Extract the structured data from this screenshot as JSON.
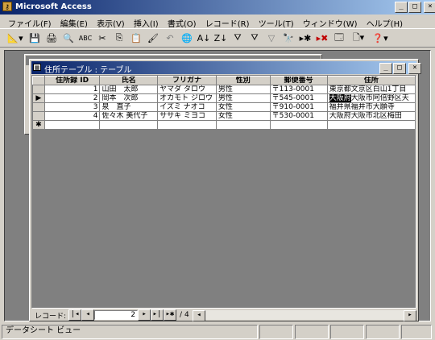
{
  "app": {
    "title": "Microsoft Access",
    "icon": "key-icon"
  },
  "menu": [
    "ファイル(F)",
    "編集(E)",
    "表示(V)",
    "挿入(I)",
    "書式(O)",
    "レコード(R)",
    "ツール(T)",
    "ウィンドウ(W)",
    "ヘルプ(H)"
  ],
  "table_window": {
    "title": "住所テーブル : テーブル",
    "columns": [
      "住所録 ID",
      "氏名",
      "フリガナ",
      "性別",
      "郵便番号",
      "住所"
    ],
    "rows": [
      [
        "1",
        "山田　太郎",
        "ヤマダ タロウ",
        "男性",
        "〒113-0001",
        "東京都文京区白山1丁目"
      ],
      [
        "2",
        "岡本　次郎",
        "オカモト ジロウ",
        "男性",
        "〒545-0001",
        "大阪府大阪市阿倍野区天"
      ],
      [
        "3",
        "泉　直子",
        "イズミ ナオコ",
        "女性",
        "〒910-0001",
        "福井県福井市大願寺"
      ],
      [
        "4",
        "佐々木 美代子",
        "ササキ ミヨコ",
        "女性",
        "〒530-0001",
        "大阪府大阪市北区梅田"
      ]
    ],
    "current_row_marker": "▶",
    "new_row_marker": "✱",
    "highlighted_text": "大阪府"
  },
  "navigator": {
    "label": "レコード:",
    "current": "2",
    "total": "/ 4"
  },
  "status_bar": {
    "text": "データシート ビュー"
  },
  "colors": {
    "title_active": "#0a246a",
    "title_active_end": "#a6caf0",
    "title_inactive": "#808080",
    "workspace": "#808080"
  }
}
